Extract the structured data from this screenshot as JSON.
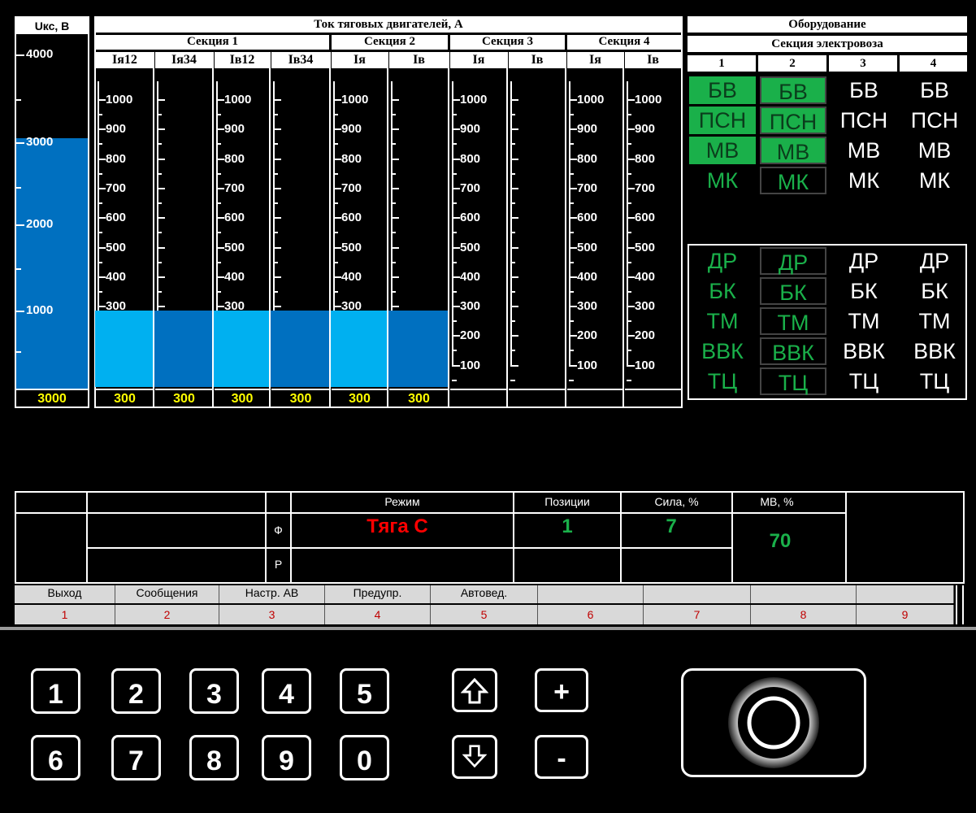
{
  "voltage": {
    "title": "Uкс, В",
    "ticks": [
      "4000",
      "3000",
      "2000",
      "1000"
    ],
    "value": "3000",
    "fill_fraction": 0.75
  },
  "current": {
    "title": "Ток тяговых двигателей, А",
    "sections": [
      "Секция 1",
      "Секция 2",
      "Секция 3",
      "Секция 4"
    ],
    "columns": [
      "Iя12",
      "Iя34",
      "Iв12",
      "Iв34",
      "Iя",
      "Iв",
      "Iя",
      "Iв",
      "Iя",
      "Iв"
    ],
    "ticks": [
      "1000",
      "900",
      "800",
      "700",
      "600",
      "500",
      "400",
      "300",
      "200",
      "100"
    ],
    "values": [
      "300",
      "300",
      "300",
      "300",
      "300",
      "300",
      "",
      "",
      "",
      ""
    ],
    "fill_value": 300,
    "max": 1000
  },
  "equipment": {
    "title": "Оборудование",
    "subtitle": "Секция электровоза",
    "columns": [
      "1",
      "2",
      "3",
      "4"
    ],
    "group1": [
      "БВ",
      "ПСН",
      "МВ",
      "МК"
    ],
    "group2": [
      "ДР",
      "БК",
      "ТМ",
      "ВВК",
      "ТЦ"
    ]
  },
  "status": {
    "mode_label": "Режим",
    "positions_label": "Позиции",
    "force_label": "Сила, %",
    "mv_label": "МВ, %",
    "phi": "Ф",
    "r": "Р",
    "mode_value": "Тяга С",
    "positions_value": "1",
    "force_value": "7",
    "mv_value": "70"
  },
  "fkeys": [
    "Выход",
    "Сообщения",
    "Настр. АВ",
    "Предупр.",
    "Автовед.",
    "",
    "",
    "",
    ""
  ],
  "fnums": [
    "1",
    "2",
    "3",
    "4",
    "5",
    "6",
    "7",
    "8",
    "9"
  ],
  "keypad": {
    "row1": [
      "1",
      "2",
      "3",
      "4",
      "5"
    ],
    "row2": [
      "6",
      "7",
      "8",
      "9",
      "0"
    ],
    "plus": "+",
    "minus": "-"
  },
  "colors": {
    "green": "#1ab04a",
    "blue": "#0070c0",
    "cyan": "#00b0f0",
    "red": "#ff0000",
    "yellow": "#ffff00"
  }
}
